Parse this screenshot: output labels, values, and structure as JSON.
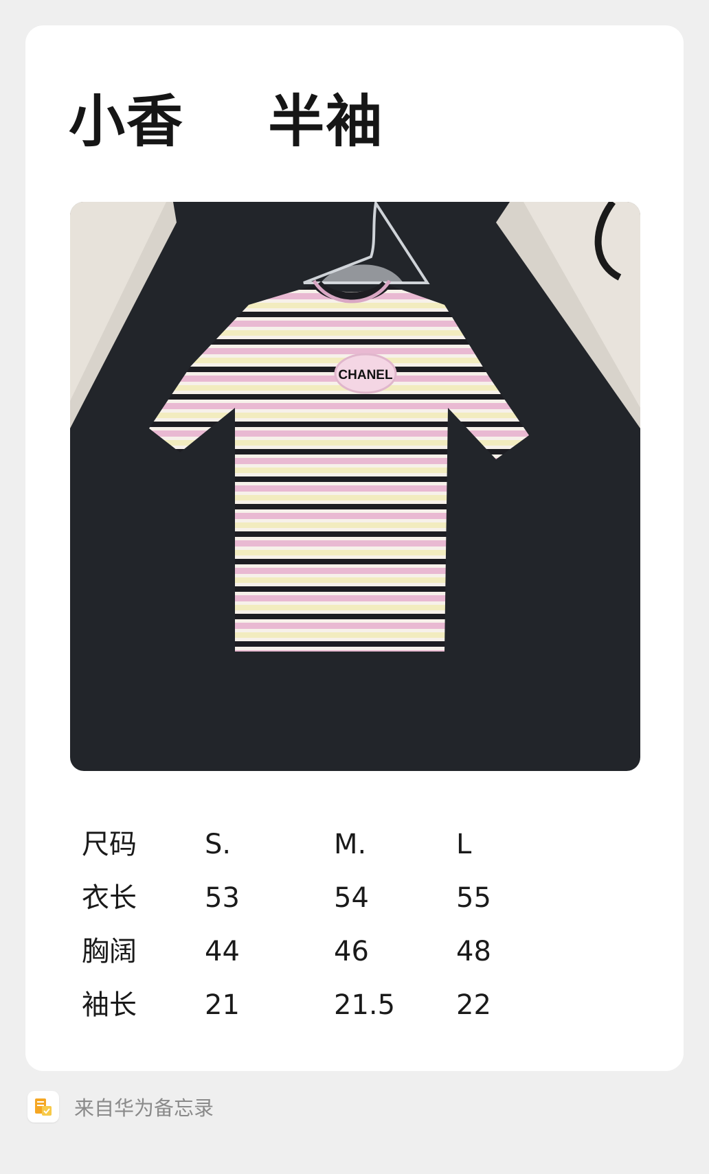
{
  "note": {
    "title": "小香    半袖",
    "image_alt": "CHANEL"
  },
  "size_table": {
    "header": [
      "尺码",
      "S.",
      "M.",
      "L"
    ],
    "rows": [
      [
        "衣长",
        "53",
        "54",
        "55"
      ],
      [
        "胸阔",
        "44",
        "46",
        "48"
      ],
      [
        "袖长",
        "21",
        "21.5",
        "22"
      ]
    ]
  },
  "footer": {
    "source_text": "来自华为备忘录",
    "icon": "notepad-app-icon"
  },
  "colors": {
    "background": "#efefef",
    "card": "#ffffff",
    "stripe_black": "#1d1d22",
    "stripe_pink": "#e9b9d2",
    "stripe_cream": "#f2ecbf"
  }
}
